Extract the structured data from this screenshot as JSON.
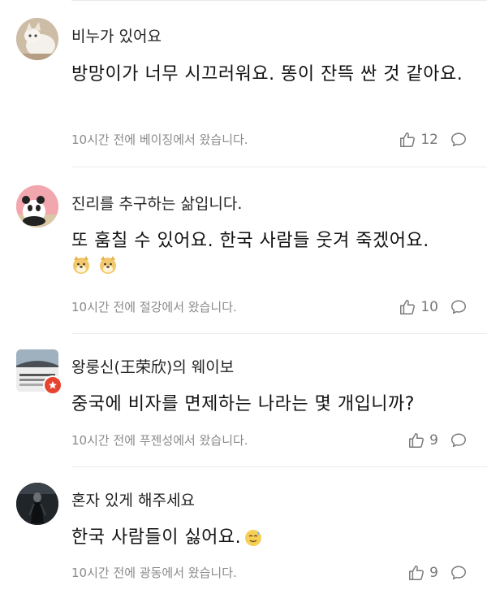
{
  "comments": [
    {
      "name": "비누가 있어요",
      "text": "방망이가 너무 시끄러워요. 똥이 잔뜩 싼 것 같아요.",
      "meta": "10시간 전에 베이징에서 왔습니다.",
      "likes": "12",
      "avatar": "cat-avatar"
    },
    {
      "name": "진리를 추구하는 삶입니다.",
      "text": "또 훔칠 수 있어요. 한국 사람들 웃겨 죽겠어요.",
      "meta": "10시간 전에 절강에서 왔습니다.",
      "likes": "10",
      "avatar": "panda-avatar"
    },
    {
      "name": "왕룽신(王荣欣)의 웨이보",
      "text": "중국에 비자를 면제하는 나라는 몇 개입니까?",
      "meta": "10시간 전에 푸젠성에서 왔습니다.",
      "likes": "9",
      "avatar": "group-photo-avatar"
    },
    {
      "name": "혼자 있게 해주세요",
      "text": "한국 사람들이 싫어요.",
      "meta": "10시간 전에 광동에서 왔습니다.",
      "likes": "9",
      "avatar": "dark-figure-avatar"
    }
  ],
  "colors": {
    "text": "#111111",
    "meta": "#8a8a8a",
    "icon": "#7a7a7a",
    "badge": "#e8432e"
  }
}
